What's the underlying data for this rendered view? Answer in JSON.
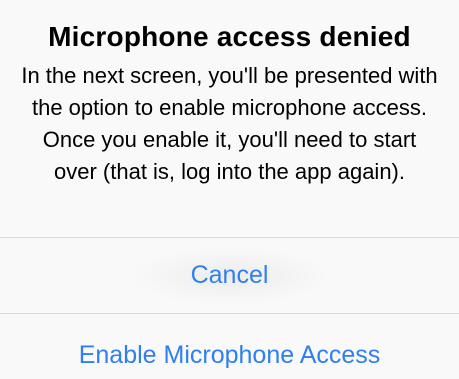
{
  "alert": {
    "title": "Microphone access denied",
    "message": "In the next screen, you'll be presented with the option to enable microphone access. Once you enable it, you'll need to start over (that is, log into the app again).",
    "actions": {
      "cancel_label": "Cancel",
      "enable_label": "Enable Microphone Access"
    }
  },
  "colors": {
    "accent": "#2f7ff0",
    "background": "#f9f9f9",
    "divider": "#d9d9db",
    "text": "#000000"
  }
}
